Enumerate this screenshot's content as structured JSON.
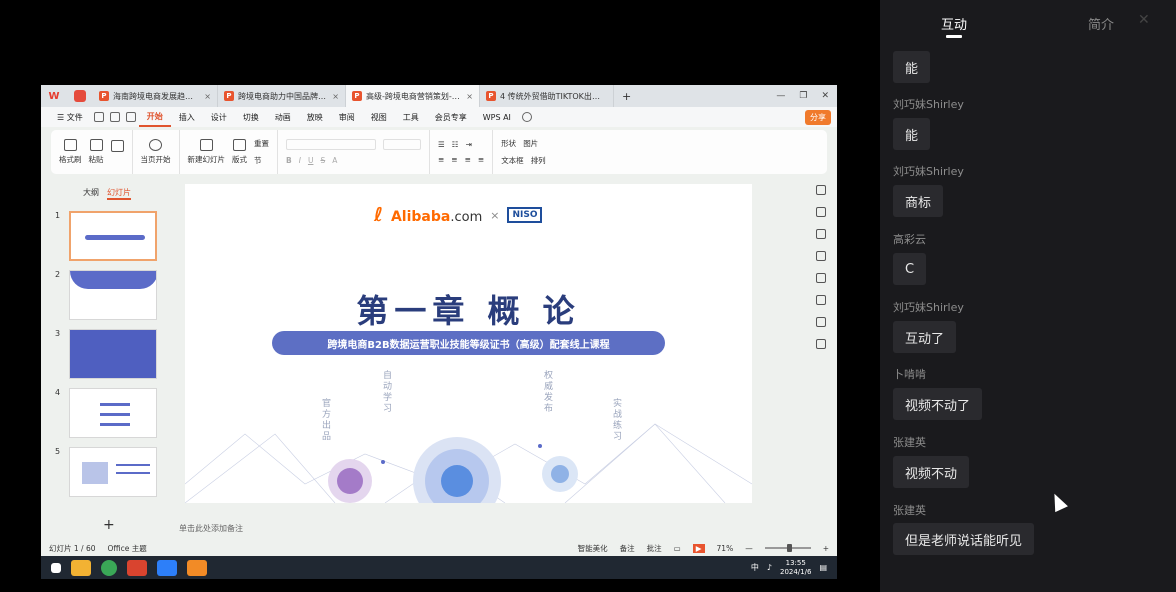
{
  "window_tabs": [
    {
      "label": "海南跨境电商发展趋势、…",
      "active": false
    },
    {
      "label": "跨境电商助力中国品牌出海—…",
      "active": false
    },
    {
      "label": "高级-跨境电商营销策划-第1章",
      "active": true
    },
    {
      "label": "4 传统外贸借助TIKTOK出海加速",
      "active": false
    }
  ],
  "menu": {
    "file": "文件",
    "items": [
      "开始",
      "插入",
      "设计",
      "切换",
      "动画",
      "放映",
      "审阅",
      "视图",
      "工具",
      "会员专享"
    ],
    "active": "开始",
    "wps_ai": "WPS AI",
    "share": "分享"
  },
  "ribbon": {
    "format_painter": "格式刷",
    "paste": "粘贴",
    "play_from_current": "当页开始",
    "new_slide": "新建幻灯片",
    "layout": "版式",
    "reset": "重置",
    "section": "节",
    "shape": "形状",
    "picture": "图片",
    "textbox": "文本框",
    "arrange": "排列"
  },
  "panel": {
    "tab_outline": "大纲",
    "tab_slides": "幻灯片",
    "thumbnail_numbers": [
      "1",
      "2",
      "3",
      "4",
      "5"
    ]
  },
  "slide": {
    "brand_text": "Alibaba",
    "brand_suffix": ".com",
    "times": "×",
    "partner": "NISO",
    "title": "第一章  概  论",
    "subtitle": "跨境电商B2B数据运营职业技能等级证书（高级）配套线上课程",
    "tags": [
      "官方出品",
      "自动学习",
      "权威发布",
      "实战练习"
    ]
  },
  "notes_placeholder": "单击此处添加备注",
  "status": {
    "slide_count": "幻灯片 1 / 60",
    "theme": "Office 主题",
    "beautify": "智能美化",
    "notes": "备注",
    "comments": "批注",
    "zoom": "71%"
  },
  "taskbar": {
    "ime": "中",
    "time": "13:55",
    "date": "2024/1/6"
  },
  "chat": {
    "tab_interact": "互动",
    "tab_intro": "简介",
    "messages": [
      {
        "name": "",
        "text": "能"
      },
      {
        "name": "刘巧妹Shirley",
        "text": "能"
      },
      {
        "name": "刘巧妹Shirley",
        "text": "商标"
      },
      {
        "name": "高彩云",
        "text": "C"
      },
      {
        "name": "刘巧妹Shirley",
        "text": "互动了"
      },
      {
        "name": "卜啃啃",
        "text": "视频不动了"
      },
      {
        "name": "张建英",
        "text": "视频不动"
      },
      {
        "name": "张建英",
        "text": "但是老师说话能听见"
      }
    ]
  }
}
